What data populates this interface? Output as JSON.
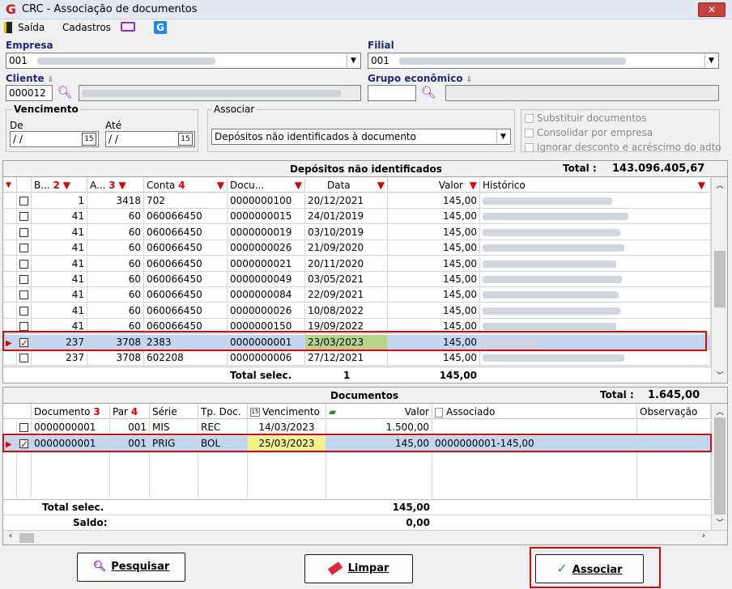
{
  "window": {
    "title": "CRC - Associação de documentos",
    "close_label": "✕"
  },
  "menu": {
    "saida": "Saída",
    "cadastros": "Cadastros"
  },
  "empresa": {
    "label": "Empresa",
    "value": "001"
  },
  "filial": {
    "label": "Filial",
    "value": "001"
  },
  "cliente": {
    "label": "Cliente",
    "code": "000012"
  },
  "grupo": {
    "label": "Grupo econômico",
    "code": ""
  },
  "vencimento": {
    "title": "Vencimento",
    "de_label": "De",
    "ate_label": "Até",
    "de_value": "/ /",
    "ate_value": "/ /"
  },
  "associar": {
    "title": "Associar",
    "value": "Depósitos não identificados à documento"
  },
  "options": {
    "substituir": "Substituir documentos",
    "consolidar": "Consolidar por empresa",
    "ignorar": "Ignorar desconto e acréscimo do adto"
  },
  "depositos": {
    "title": "Depósitos não identificados",
    "total_label": "Total :",
    "total_value": "143.096.405,67",
    "headers": {
      "b": "B...",
      "b_n": "2",
      "a": "A...",
      "a_n": "3",
      "conta": "Conta",
      "conta_n": "4",
      "docu": "Docu...",
      "data": "Data",
      "valor": "Valor",
      "historico": "Histórico"
    },
    "rows": [
      {
        "b": "1",
        "a": "3418",
        "conta": "702",
        "docu": "0000000100",
        "data": "20/12/2021",
        "valor": "145,00"
      },
      {
        "b": "41",
        "a": "60",
        "conta": "060066450",
        "docu": "0000000015",
        "data": "24/01/2019",
        "valor": "145,00"
      },
      {
        "b": "41",
        "a": "60",
        "conta": "060066450",
        "docu": "0000000019",
        "data": "03/10/2019",
        "valor": "145,00"
      },
      {
        "b": "41",
        "a": "60",
        "conta": "060066450",
        "docu": "0000000026",
        "data": "21/09/2020",
        "valor": "145,00"
      },
      {
        "b": "41",
        "a": "60",
        "conta": "060066450",
        "docu": "0000000021",
        "data": "20/11/2020",
        "valor": "145,00"
      },
      {
        "b": "41",
        "a": "60",
        "conta": "060066450",
        "docu": "0000000049",
        "data": "03/05/2021",
        "valor": "145,00"
      },
      {
        "b": "41",
        "a": "60",
        "conta": "060066450",
        "docu": "0000000084",
        "data": "22/09/2021",
        "valor": "145,00"
      },
      {
        "b": "41",
        "a": "60",
        "conta": "060066450",
        "docu": "0000000026",
        "data": "10/08/2022",
        "valor": "145,00"
      },
      {
        "b": "41",
        "a": "60",
        "conta": "060066450",
        "docu": "0000000150",
        "data": "19/09/2022",
        "valor": "145,00"
      },
      {
        "b": "237",
        "a": "3708",
        "conta": "2383",
        "docu": "0000000001",
        "data": "23/03/2023",
        "valor": "145,00"
      },
      {
        "b": "237",
        "a": "3708",
        "conta": "602208",
        "docu": "0000000006",
        "data": "27/12/2021",
        "valor": "145,00"
      }
    ],
    "footer": {
      "label": "Total selec.",
      "count": "1",
      "value": "145,00"
    }
  },
  "documentos": {
    "title": "Documentos",
    "total_label": "Total :",
    "total_value": "1.645,00",
    "headers": {
      "documento": "Documento",
      "documento_n": "3",
      "par": "Par",
      "par_n": "4",
      "serie": "Série",
      "tpdoc": "Tp. Doc.",
      "vencimento": "Vencimento",
      "valor": "Valor",
      "associado": "Associado",
      "observacao": "Observação"
    },
    "rows": [
      {
        "documento": "0000000001",
        "par": "001",
        "serie": "MIS",
        "tpdoc": "REC",
        "vencimento": "14/03/2023",
        "valor": "1.500,00",
        "associado": ""
      },
      {
        "documento": "0000000001",
        "par": "001",
        "serie": "PRIG",
        "tpdoc": "BOL",
        "vencimento": "25/03/2023",
        "valor": "145,00",
        "associado": "0000000001-145,00"
      }
    ],
    "footer": {
      "total_label": "Total selec.",
      "total_value": "145,00",
      "saldo_label": "Saldo:",
      "saldo_value": "0,00"
    }
  },
  "buttons": {
    "pesquisar": "Pesquisar",
    "limpar": "Limpar",
    "associar": "Associar"
  }
}
